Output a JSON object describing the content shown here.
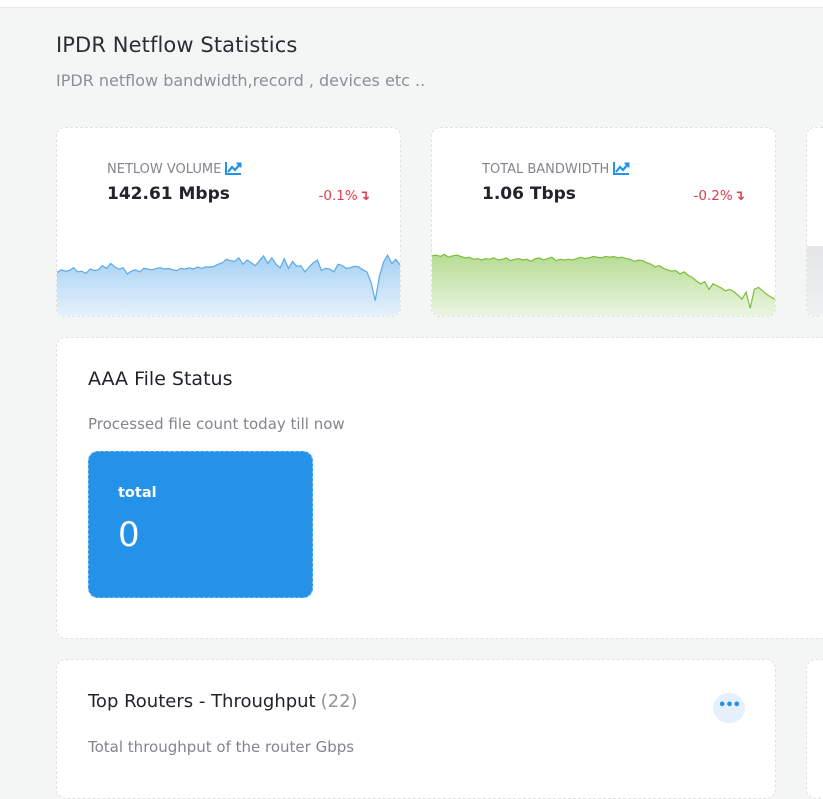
{
  "header": {
    "title": "IPDR Netflow Statistics",
    "subtitle": "IPDR netflow bandwidth,record , devices etc .."
  },
  "stats": [
    {
      "label": "NETLOW VOLUME",
      "value": "142.61 Mbps",
      "delta": "-0.1%",
      "icon": "trend-chart-icon",
      "sparkline_color": "#5aa9ea",
      "sparkline": [
        6.2,
        6.6,
        6.4,
        6.5,
        6.9,
        6.3,
        6.4,
        6.1,
        6.7,
        6.5,
        6.6,
        7.2,
        6.8,
        7.5,
        7.0,
        6.7,
        6.9,
        6.0,
        6.4,
        6.6,
        6.3,
        6.8,
        6.7,
        6.6,
        6.8,
        6.9,
        6.7,
        6.8,
        6.6,
        6.5,
        6.8,
        6.7,
        6.9,
        6.7,
        7.0,
        6.8,
        7.0,
        7.0,
        7.1,
        7.4,
        7.6,
        8.1,
        7.9,
        7.8,
        8.3,
        7.4,
        8.0,
        7.6,
        7.2,
        7.9,
        8.6,
        7.5,
        8.3,
        7.4,
        6.9,
        8.2,
        6.8,
        7.8,
        7.1,
        7.2,
        6.3,
        7.0,
        7.6,
        8.0,
        6.5,
        6.8,
        6.7,
        6.3,
        7.4,
        7.2,
        6.8,
        6.9,
        7.1,
        7.0,
        6.6,
        6.3,
        4.8,
        2.2,
        5.6,
        7.7,
        8.7,
        7.5,
        8.1,
        7.3
      ]
    },
    {
      "label": "TOTAL BANDWIDTH",
      "value": "1.06 Tbps",
      "delta": "-0.2%",
      "icon": "trend-chart-icon",
      "sparkline_color": "#7bbf3a",
      "sparkline": [
        8.6,
        8.7,
        8.5,
        8.8,
        8.4,
        8.6,
        8.7,
        8.5,
        8.3,
        8.4,
        8.1,
        8.2,
        8.0,
        8.2,
        8.1,
        8.3,
        8.0,
        8.1,
        8.3,
        7.9,
        8.1,
        8.2,
        8.0,
        8.1,
        7.8,
        8.2,
        8.3,
        8.0,
        8.2,
        8.4,
        7.9,
        8.1,
        8.0,
        8.1,
        8.0,
        8.2,
        8.4,
        8.2,
        8.3,
        8.5,
        8.4,
        8.3,
        8.5,
        8.4,
        8.5,
        8.3,
        8.4,
        8.2,
        8.1,
        7.8,
        8.0,
        7.9,
        7.6,
        7.4,
        7.0,
        7.2,
        6.8,
        6.6,
        6.4,
        6.5,
        6.0,
        6.3,
        5.8,
        5.5,
        5.0,
        4.6,
        4.9,
        3.8,
        4.6,
        4.3,
        4.0,
        3.6,
        3.8,
        3.5,
        3.0,
        2.4,
        3.4,
        1.1,
        3.8,
        4.1,
        3.6,
        3.1,
        2.7,
        2.4
      ]
    }
  ],
  "aaa": {
    "title": "AAA File Status",
    "subtitle": "Processed file count today till now",
    "total_label": "total",
    "total_value": "0",
    "box_color": "#2392e8"
  },
  "routers": {
    "title": "Top Routers - Throughput",
    "count": "(22)",
    "subtitle": "Total throughput of the router Gbps",
    "more_icon": "more-options-icon",
    "more_glyph": "•••"
  }
}
